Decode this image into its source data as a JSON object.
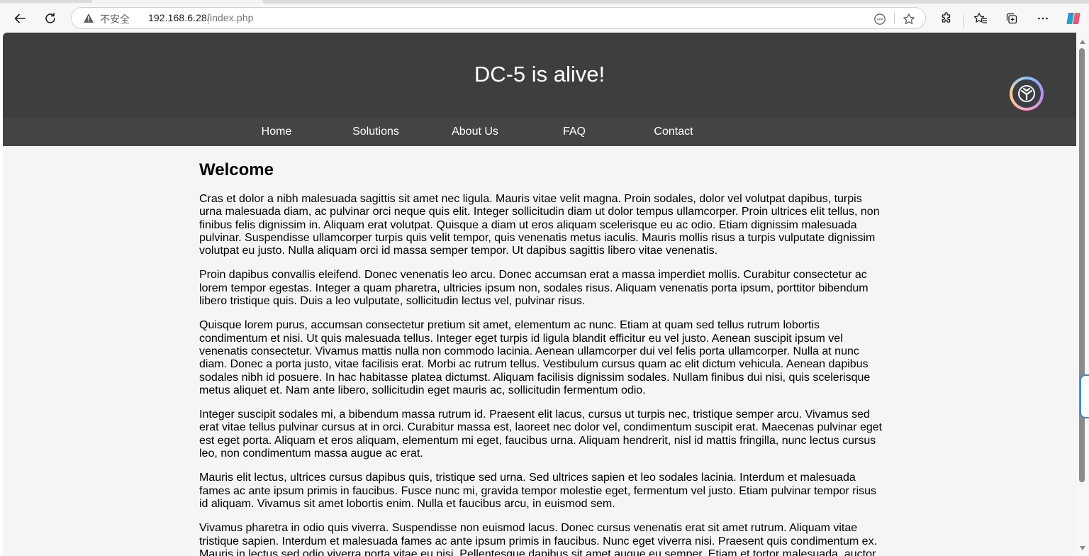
{
  "browser": {
    "address": {
      "security_label": "不安全",
      "url_host": "192.168.6.28",
      "url_path": "/index.php"
    },
    "icons": {
      "back": "back-arrow-icon",
      "reload": "reload-icon",
      "warning": "warning-triangle-icon",
      "reader": "reader-mode-icon",
      "favorite": "star-icon",
      "extensions": "puzzle-icon",
      "favorites": "favorites-icon",
      "collections": "collections-icon",
      "more": "more-dots-icon",
      "copilot": "copilot-icon"
    }
  },
  "site": {
    "title": "DC-5 is alive!",
    "nav": [
      "Home",
      "Solutions",
      "About Us",
      "FAQ",
      "Contact"
    ]
  },
  "content": {
    "heading": "Welcome",
    "paragraphs": [
      "Cras et dolor a nibh malesuada sagittis sit amet nec ligula. Mauris vitae velit magna. Proin sodales, dolor vel volutpat dapibus, turpis urna malesuada diam, ac pulvinar orci neque quis elit. Integer sollicitudin diam ut dolor tempus ullamcorper. Proin ultrices elit tellus, non finibus felis dignissim in. Aliquam erat volutpat. Quisque a diam ut eros aliquam scelerisque eu ac odio. Etiam dignissim malesuada pulvinar. Suspendisse ullamcorper turpis quis velit tempor, quis venenatis metus iaculis. Mauris mollis risus a turpis vulputate dignissim volutpat eu justo. Nulla aliquam orci id massa semper tempor. Ut dapibus sagittis libero vitae venenatis.",
      "Proin dapibus convallis eleifend. Donec venenatis leo arcu. Donec accumsan erat a massa imperdiet mollis. Curabitur consectetur ac lorem tempor egestas. Integer a quam pharetra, ultricies ipsum non, sodales risus. Aliquam venenatis porta ipsum, porttitor bibendum libero tristique quis. Duis a leo vulputate, sollicitudin lectus vel, pulvinar risus.",
      "Quisque lorem purus, accumsan consectetur pretium sit amet, elementum ac nunc. Etiam at quam sed tellus rutrum lobortis condimentum et nisi. Ut quis malesuada tellus. Integer eget turpis id ligula blandit efficitur eu vel justo. Aenean suscipit ipsum vel venenatis consectetur. Vivamus mattis nulla non commodo lacinia. Aenean ullamcorper dui vel felis porta ullamcorper. Nulla at nunc diam. Donec a porta justo, vitae facilisis erat. Morbi ac rutrum tellus. Vestibulum cursus quam ac elit dictum vehicula. Aenean dapibus sodales nibh id posuere. In hac habitasse platea dictumst. Aliquam facilisis dignissim sodales. Nullam finibus dui nisi, quis scelerisque metus aliquet et. Nam ante libero, sollicitudin eget mauris ac, sollicitudin fermentum odio.",
      "Integer suscipit sodales mi, a bibendum massa rutrum id. Praesent elit lacus, cursus ut turpis nec, tristique semper arcu. Vivamus sed erat vitae tellus pulvinar cursus at in orci. Curabitur massa est, laoreet nec dolor vel, condimentum suscipit erat. Maecenas pulvinar eget est eget porta. Aliquam et eros aliquam, elementum mi eget, faucibus urna. Aliquam hendrerit, nisl id mattis fringilla, nunc lectus cursus leo, non condimentum massa augue ac erat.",
      "Mauris elit lectus, ultrices cursus dapibus quis, tristique sed urna. Sed ultrices sapien et leo sodales lacinia. Interdum et malesuada fames ac ante ipsum primis in faucibus. Fusce nunc mi, gravida tempor molestie eget, fermentum vel justo. Etiam pulvinar tempor risus id aliquam. Vivamus sit amet lobortis enim. Nulla et faucibus arcu, in euismod sem.",
      "Vivamus pharetra in odio quis viverra. Suspendisse non euismod lacus. Donec cursus venenatis erat sit amet rutrum. Aliquam vitae tristique sapien. Interdum et malesuada fames ac ante ipsum primis in faucibus. Nunc eget viverra nisi. Praesent quis condimentum ex. Mauris in lectus sed odio viverra porta vitae eu nisi. Pellentesque dapibus sit amet augue eu semper. Etiam et tortor malesuada, auctor"
    ]
  },
  "colors": {
    "header_bg": "#3e3e3e",
    "nav_bg": "#444444",
    "page_bg": "#f5f5f5",
    "text": "#000000"
  }
}
